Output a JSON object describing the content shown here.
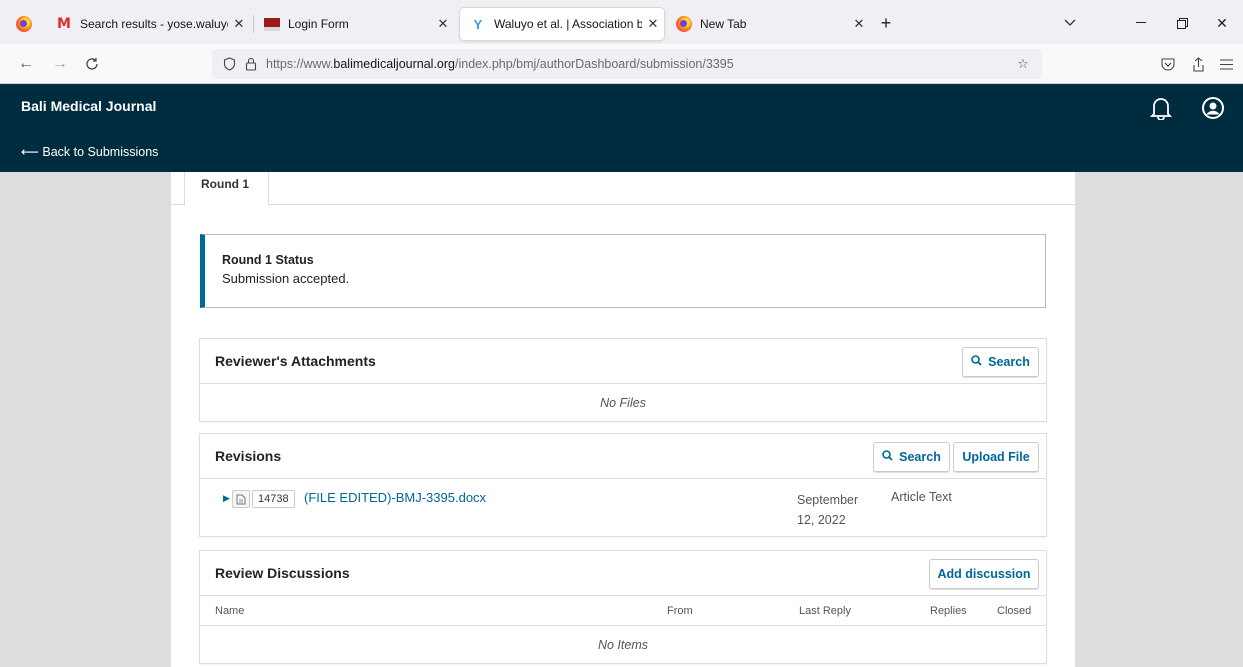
{
  "browser": {
    "tabs": [
      {
        "title": "Search results - yose.waluyo@m",
        "icon": "gmail-icon"
      },
      {
        "title": "Login Form",
        "icon": "login-form-icon"
      },
      {
        "title": "Waluyo et al. | Association betw",
        "icon": "ojs-icon"
      },
      {
        "title": "New Tab",
        "icon": "firefox-icon"
      }
    ],
    "url": {
      "prefix": "https://www.",
      "domain": "balimedicaljournal.org",
      "path": "/index.php/bmj/authorDashboard/submission/3395"
    }
  },
  "header": {
    "title": "Bali Medical Journal",
    "back_link": "⟵ Back to Submissions"
  },
  "round_tab": "Round 1",
  "status": {
    "title": "Round 1 Status",
    "text": "Submission accepted."
  },
  "reviewer_attachments": {
    "title": "Reviewer's Attachments",
    "search_label": "Search",
    "empty": "No Files"
  },
  "revisions": {
    "title": "Revisions",
    "search_label": "Search",
    "upload_label": "Upload File",
    "file": {
      "id": "14738",
      "name": "(FILE EDITED)-BMJ-3395.docx",
      "date": "September 12, 2022",
      "type": "Article Text"
    }
  },
  "review_discussions": {
    "title": "Review Discussions",
    "add_label": "Add discussion",
    "columns": [
      "Name",
      "From",
      "Last Reply",
      "Replies",
      "Closed"
    ],
    "empty": "No Items"
  },
  "colors": {
    "header_bg": "#002c40",
    "accent": "#006798"
  }
}
